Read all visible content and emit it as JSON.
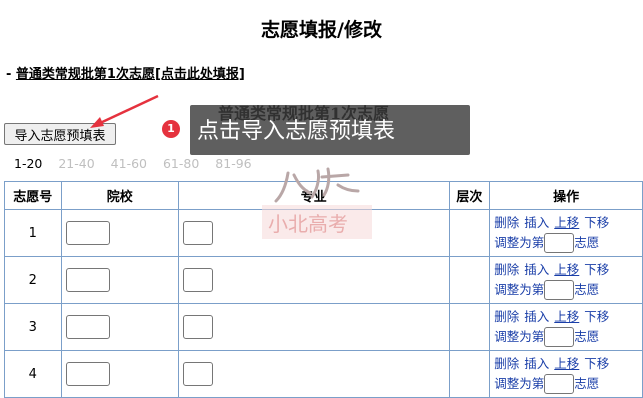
{
  "page": {
    "title": "志愿填报/修改",
    "subtitle_prefix": "- ",
    "subtitle_link": "普通类常规批第1次志愿[点击此处填报]",
    "section_title": "普通类常规批第1次志愿"
  },
  "toolbar": {
    "import_label": "导入志愿预填表"
  },
  "pagination": [
    "1-20",
    "21-40",
    "41-60",
    "61-80",
    "81-96"
  ],
  "table": {
    "headers": [
      "志愿号",
      "院校",
      "专业",
      "层次",
      "操作"
    ],
    "rows": [
      {
        "num": "1"
      },
      {
        "num": "2"
      },
      {
        "num": "3"
      },
      {
        "num": "4"
      }
    ]
  },
  "ops": {
    "delete": "删除",
    "insert": "插入",
    "up": "上移",
    "down": "下移",
    "adjust_prefix": "调整为第",
    "adjust_suffix": "志愿"
  },
  "annotation": {
    "badge": "1",
    "text": "点击导入志愿预填表"
  },
  "colors": {
    "callout_bg": "#3c3c3c",
    "badge": "#e5323e",
    "arrow": "#e5323e",
    "link": "#1a3ea8",
    "table_border": "#7b9fc9"
  }
}
